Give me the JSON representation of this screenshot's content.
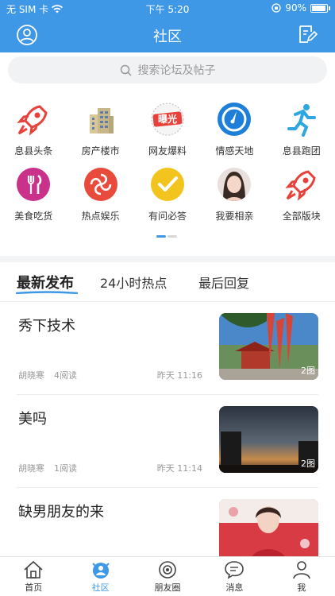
{
  "status": {
    "carrier": "无 SIM 卡",
    "time": "下午 5:20",
    "battery": "90%"
  },
  "nav": {
    "title": "社区"
  },
  "search": {
    "placeholder": "搜索论坛及帖子"
  },
  "categories": [
    {
      "label": "息县头条",
      "icon": "rocket-icon"
    },
    {
      "label": "房产楼市",
      "icon": "building-icon"
    },
    {
      "label": "网友爆料",
      "icon": "exposure-badge-icon",
      "badge_text": "曝光"
    },
    {
      "label": "情感天地",
      "icon": "compass-icon"
    },
    {
      "label": "息县跑团",
      "icon": "runner-icon"
    },
    {
      "label": "美食吃货",
      "icon": "fork-knife-icon"
    },
    {
      "label": "热点娱乐",
      "icon": "swirl-icon"
    },
    {
      "label": "有问必答",
      "icon": "checkmark-icon"
    },
    {
      "label": "我要相亲",
      "icon": "portrait-avatar-icon"
    },
    {
      "label": "全部版块",
      "icon": "rocket-icon"
    }
  ],
  "tabs": {
    "latest": "最新发布",
    "hot24": "24小时热点",
    "lastReply": "最后回复"
  },
  "posts": [
    {
      "title": "秀下技术",
      "author": "胡晓寒",
      "reads": "4阅读",
      "time": "昨天 11:16",
      "badge": "2图"
    },
    {
      "title": "美吗",
      "author": "胡晓寒",
      "reads": "1阅读",
      "time": "昨天 11:14",
      "badge": "2图"
    },
    {
      "title": "缺男朋友的来",
      "author": "",
      "reads": "",
      "time": "",
      "badge": ""
    }
  ],
  "tabbar": [
    {
      "label": "首页",
      "icon": "home-icon"
    },
    {
      "label": "社区",
      "icon": "community-icon"
    },
    {
      "label": "朋友圈",
      "icon": "friends-circle-icon"
    },
    {
      "label": "消息",
      "icon": "message-icon"
    },
    {
      "label": "我",
      "icon": "profile-icon"
    }
  ],
  "colors": {
    "accent": "#3f98e6",
    "red": "#e8403a",
    "yellow": "#f4c41e"
  }
}
